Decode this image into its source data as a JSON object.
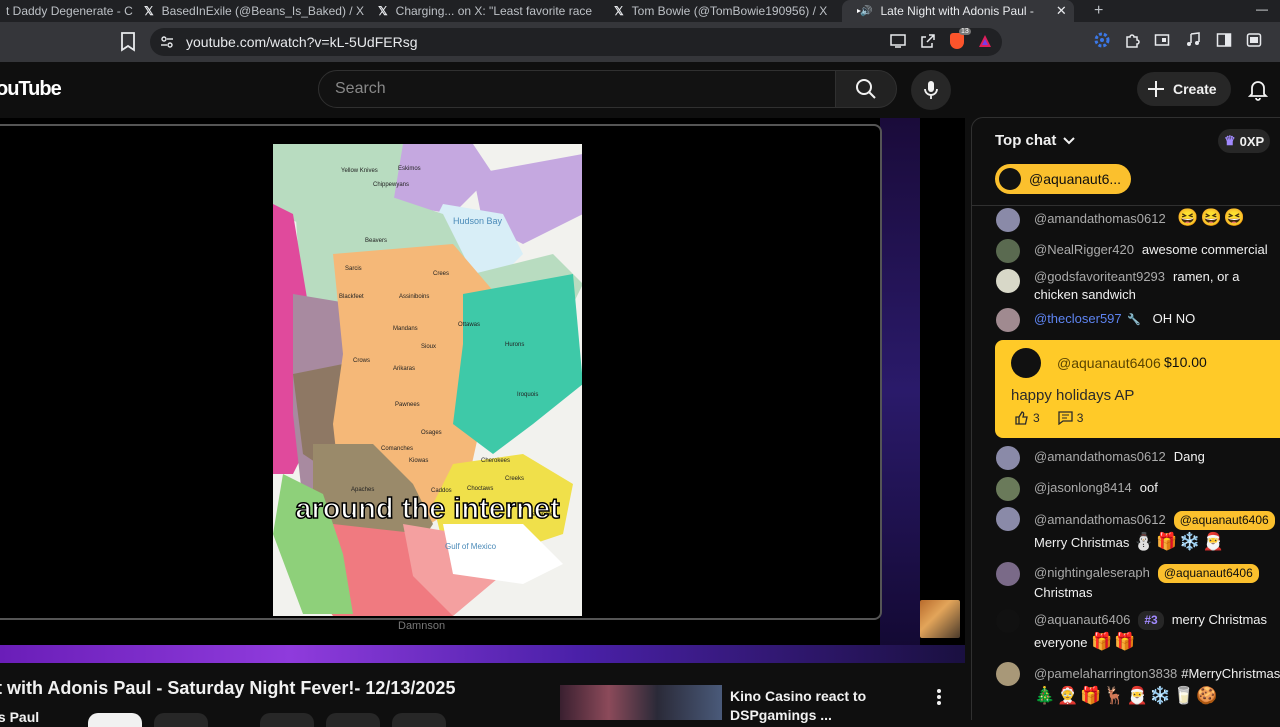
{
  "browser": {
    "tabs": [
      {
        "label": "t Daddy Degenerate - C",
        "icon": "none"
      },
      {
        "label": "BasedInExile (@Beans_Is_Baked) / X",
        "icon": "x-logo"
      },
      {
        "label": "Charging... on X: \"Least favorite race",
        "icon": "x-logo"
      },
      {
        "label": "Tom Bowie (@TomBowie190956) / X",
        "icon": "x-logo"
      },
      {
        "label": "Late Night with Adonis Paul -",
        "icon": "youtube-logo"
      }
    ],
    "tab_close": "✕",
    "new_tab": "+",
    "x_glyph": "𝕏",
    "url": "youtube.com/watch?v=kL-5UdFERsg",
    "brave_badge": "13"
  },
  "youtube": {
    "logo": "ouTube",
    "search_placeholder": "Search",
    "create_label": "Create"
  },
  "video": {
    "caption": "around the internet",
    "map_credit": "Damnson",
    "map_labels": [
      "Eskimos",
      "Yellow Knives",
      "Chippewyans",
      "Hudson Bay",
      "Beavers",
      "Crees",
      "Sarcis",
      "Blackfeet",
      "Assiniboins",
      "Crows",
      "Mandans",
      "Sioux",
      "Arikaras",
      "Ottawas",
      "Hurons",
      "Pawnees",
      "Osages",
      "Kiowas",
      "Apaches",
      "Caddos",
      "Choctaws",
      "Creeks",
      "Gulf of Mexico",
      "Comanches",
      "Seminoles",
      "Cherokees",
      "Iroquois"
    ],
    "title": "t with Adonis Paul - Saturday Night Fever!- 12/13/2025",
    "channel": "is Paul"
  },
  "recommended": {
    "title_line1": "Kino Casino react to",
    "title_line2": "DSPgamings ..."
  },
  "chat": {
    "header": "Top chat",
    "xp": "0XP",
    "ticker_name": "@aquanaut6...",
    "messages": [
      {
        "author": "@amandathomas0612",
        "text": "",
        "emojis": "😆😆😆",
        "avatar_color": "#8a8aa8"
      },
      {
        "author": "@NealRigger420",
        "text": "awesome commercial",
        "avatar_color": "#5a6a50"
      },
      {
        "author": "@godsfavoriteant9293",
        "text": "ramen, or a chicken sandwich",
        "avatar_color": "#d8d8c8"
      },
      {
        "author": "@thecloser597",
        "text": "OH NO",
        "wrench": "🔧",
        "avatar_color": "#a08a90"
      },
      {
        "author": "@amandathomas0612",
        "text": "Dang",
        "avatar_color": "#8a8aa8"
      },
      {
        "author": "@jasonlong8414",
        "text": "oof",
        "avatar_color": "#6a7a5a"
      },
      {
        "author": "@amandathomas0612",
        "mention": "@aquanaut6406",
        "text": "Merry Christmas",
        "emojis": "⛄🎁❄️🎅",
        "avatar_color": "#8a8aa8"
      },
      {
        "author": "@nightingaleseraph",
        "mention": "@aquanaut6406",
        "text": "Christmas",
        "avatar_color": "#7a6a88"
      },
      {
        "author": "@aquanaut6406",
        "badge": "#3",
        "text": "merry Christmas everyone",
        "emojis": "🎁🎁",
        "avatar_color": "#111111"
      },
      {
        "author": "@pamelaharrington3838",
        "text": "#MerryChristmas",
        "emojis": "🎄🤶🎁🦌🎅❄️🥛🍪",
        "avatar_color": "#a89878"
      }
    ],
    "superchat": {
      "author": "@aquanaut6406",
      "amount": "$10.00",
      "message": "happy holidays AP",
      "likes": "3",
      "replies": "3"
    }
  }
}
